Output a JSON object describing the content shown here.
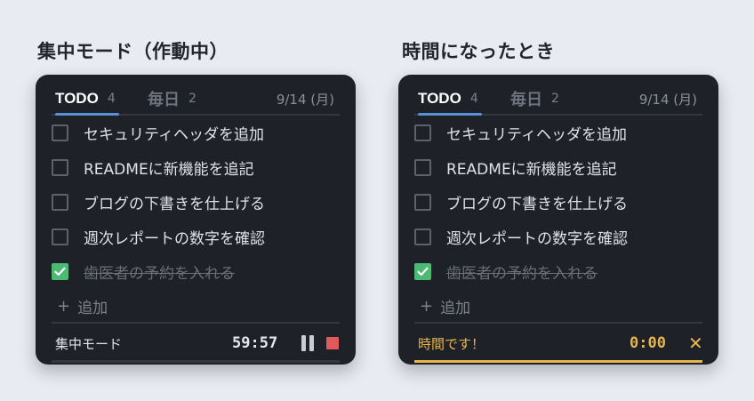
{
  "left": {
    "caption": "集中モード（作動中）",
    "tabs": {
      "todo_label": "TODO",
      "todo_count": "4",
      "daily_label": "毎日",
      "daily_count": "2"
    },
    "date": "9/14 (月)",
    "items": [
      {
        "label": "セキュリティヘッダを追加",
        "done": false
      },
      {
        "label": "READMEに新機能を追記",
        "done": false
      },
      {
        "label": "ブログの下書きを仕上げる",
        "done": false
      },
      {
        "label": "週次レポートの数字を確認",
        "done": false
      },
      {
        "label": "歯医者の予約を入れる",
        "done": true
      }
    ],
    "add_plus": "+",
    "add_label": "追加",
    "footer": {
      "label": "集中モード",
      "timer": "59:57"
    }
  },
  "right": {
    "caption": "時間になったとき",
    "tabs": {
      "todo_label": "TODO",
      "todo_count": "4",
      "daily_label": "毎日",
      "daily_count": "2"
    },
    "date": "9/14 (月)",
    "items": [
      {
        "label": "セキュリティヘッダを追加",
        "done": false
      },
      {
        "label": "READMEに新機能を追記",
        "done": false
      },
      {
        "label": "ブログの下書きを仕上げる",
        "done": false
      },
      {
        "label": "週次レポートの数字を確認",
        "done": false
      },
      {
        "label": "歯医者の予約を入れる",
        "done": true
      }
    ],
    "add_plus": "+",
    "add_label": "追加",
    "footer": {
      "label": "時間です！",
      "timer": "0:00",
      "close_glyph": "✕"
    }
  },
  "colors": {
    "background": "#e8ebf1",
    "panel": "#1f2128",
    "accent_blue": "#5b8fd6",
    "check_green": "#4cba72",
    "stop_red": "#e05a5a",
    "alarm_amber": "#e9b64a"
  },
  "icons": [
    "pause-icon",
    "stop-icon",
    "close-icon",
    "checkmark-icon"
  ]
}
